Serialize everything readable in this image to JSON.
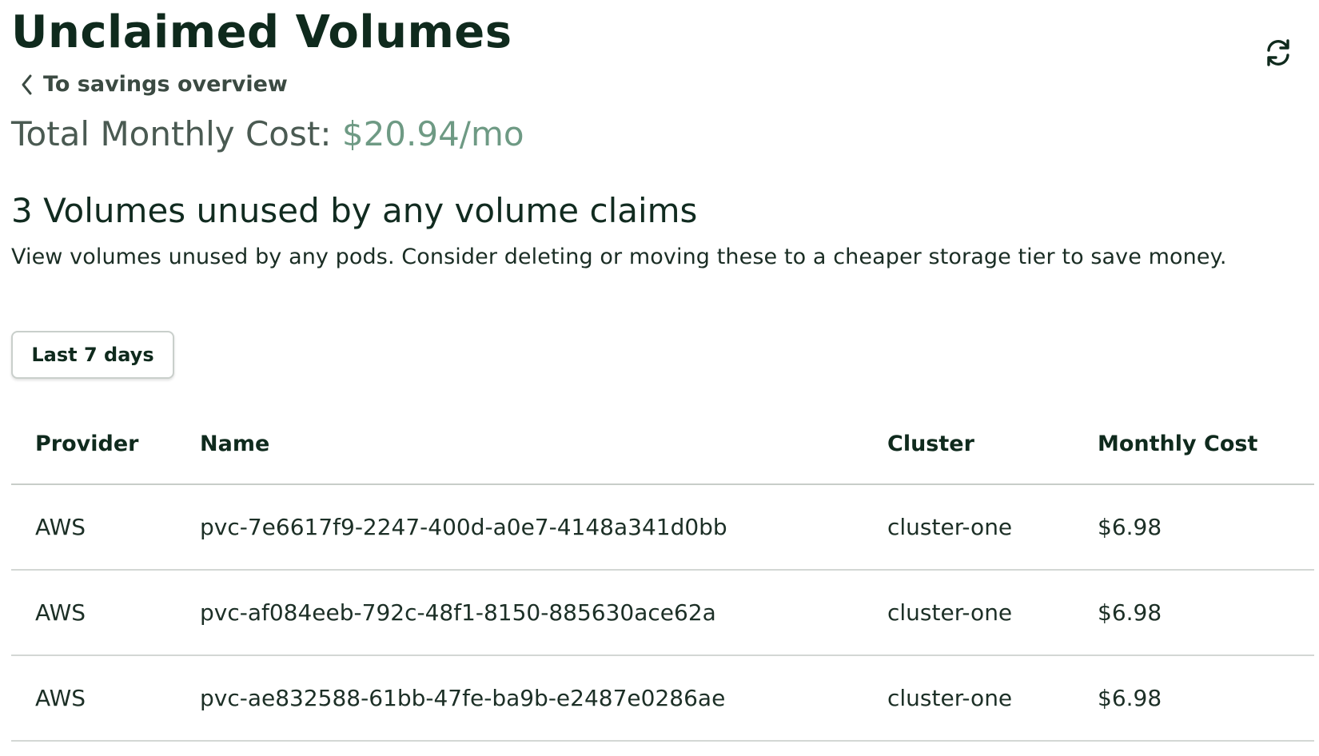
{
  "header": {
    "title": "Unclaimed Volumes",
    "back_link": "To savings overview",
    "total_cost_label": "Total Monthly Cost:",
    "total_cost_value": "$20.94/mo",
    "refresh_icon": "refresh-icon"
  },
  "section": {
    "heading": "3 Volumes unused by any volume claims",
    "description": "View volumes unused by any pods. Consider deleting or moving these to a cheaper storage tier to save money."
  },
  "filters": {
    "range_label": "Last 7 days"
  },
  "table": {
    "columns": [
      "Provider",
      "Name",
      "Cluster",
      "Monthly Cost"
    ],
    "rows": [
      [
        "AWS",
        "pvc-7e6617f9-2247-400d-a0e7-4148a341d0bb",
        "cluster-one",
        "$6.98"
      ],
      [
        "AWS",
        "pvc-af084eeb-792c-48f1-8150-885630ace62a",
        "cluster-one",
        "$6.98"
      ],
      [
        "AWS",
        "pvc-ae832588-61bb-47fe-ba9b-e2487e0286ae",
        "cluster-one",
        "$6.98"
      ]
    ]
  },
  "colors": {
    "title": "#0f2a1d",
    "cost_accent": "#6e9a84",
    "divider": "#c8cdc9"
  }
}
